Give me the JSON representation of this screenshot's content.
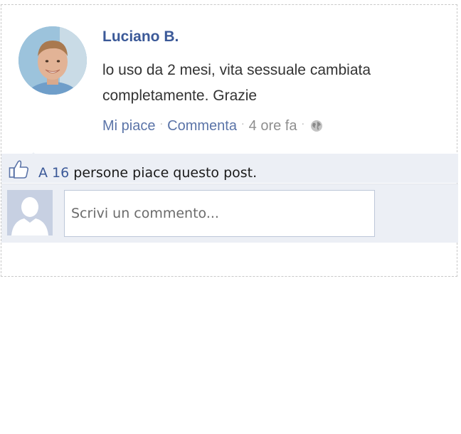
{
  "post": {
    "author": "Luciano B.",
    "text": "lo uso da 2 mesi, vita sessuale cambiata completamente. Grazie",
    "actions": {
      "like": "Mi piace",
      "comment": "Commenta",
      "time": "4 ore fa",
      "separator": "·",
      "privacy_icon": "globe-icon"
    }
  },
  "likes": {
    "icon": "thumbs-up-icon",
    "prefix": "A",
    "count": "16",
    "suffix": "persone piace questo post."
  },
  "comment_box": {
    "placeholder": "Scrivi un commento...",
    "avatar_icon": "default-user-silhouette-icon"
  },
  "colors": {
    "link": "#3b5998",
    "bar_background": "#eceff5",
    "text": "#333333",
    "muted": "#8f8f8f"
  }
}
